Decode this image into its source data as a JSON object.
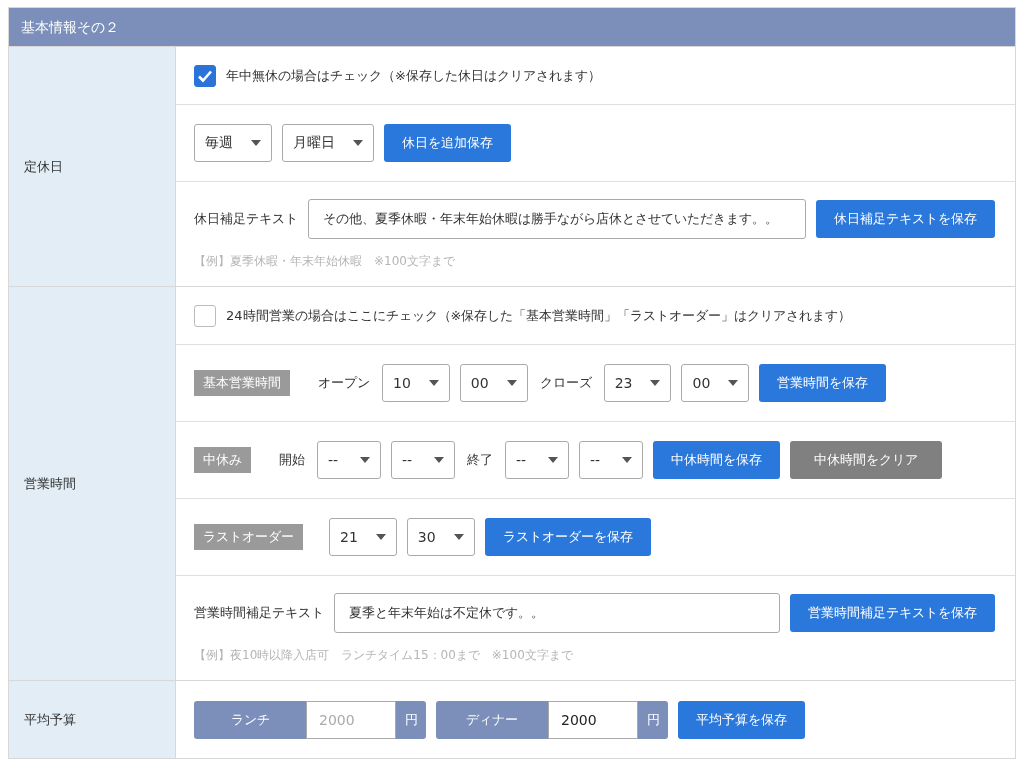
{
  "header": {
    "title": "基本情報その２"
  },
  "sections": [
    {
      "label": "定休日",
      "rows": [
        {
          "kind": "checkbox",
          "label": "年中無休の場合はチェック（※保存した休日はクリアされます）",
          "checked": true
        },
        {
          "kind": "controls",
          "items": [
            {
              "kind": "select",
              "value": "毎週"
            },
            {
              "kind": "select",
              "value": "月曜日"
            },
            {
              "kind": "button",
              "label": "休日を追加保存"
            }
          ]
        },
        {
          "kind": "text",
          "label": "休日補足テキスト",
          "value": "その他、夏季休暇・年末年始休暇は勝手ながら店休とさせていただきます。。",
          "button": "休日補足テキストを保存",
          "hint": "【例】夏季休暇・年末年始休暇　※100文字まで"
        }
      ]
    },
    {
      "label": "営業時間",
      "rows": [
        {
          "kind": "checkbox",
          "label": "24時間営業の場合はここにチェック（※保存した「基本営業時間」「ラストオーダー」はクリアされます）",
          "checked": false
        },
        {
          "kind": "controls",
          "items": [
            {
              "kind": "tag",
              "label": "基本営業時間"
            },
            {
              "kind": "label",
              "label": "オープン"
            },
            {
              "kind": "select",
              "value": "10"
            },
            {
              "kind": "select",
              "value": "00"
            },
            {
              "kind": "label",
              "label": "クローズ"
            },
            {
              "kind": "select",
              "value": "23"
            },
            {
              "kind": "select",
              "value": "00"
            },
            {
              "kind": "button",
              "label": "営業時間を保存"
            }
          ]
        },
        {
          "kind": "controls",
          "items": [
            {
              "kind": "tag",
              "label": "中休み"
            },
            {
              "kind": "label",
              "label": "開始"
            },
            {
              "kind": "select",
              "value": "--"
            },
            {
              "kind": "select",
              "value": "--"
            },
            {
              "kind": "label",
              "label": "終了"
            },
            {
              "kind": "select",
              "value": "--"
            },
            {
              "kind": "select",
              "value": "--"
            },
            {
              "kind": "button",
              "label": "中休時間を保存"
            },
            {
              "kind": "clear",
              "label": "中休時間をクリア"
            }
          ]
        },
        {
          "kind": "controls",
          "items": [
            {
              "kind": "tag",
              "label": "ラストオーダー"
            },
            {
              "kind": "select",
              "value": "21"
            },
            {
              "kind": "select",
              "value": "30"
            },
            {
              "kind": "button",
              "label": "ラストオーダーを保存"
            }
          ]
        },
        {
          "kind": "text",
          "label": "営業時間補足テキスト",
          "value": "夏季と年末年始は不定休です。。",
          "button": "営業時間補足テキストを保存",
          "hint": "【例】夜10時以降入店可　ランチタイム15：00まで　※100文字まで"
        }
      ]
    },
    {
      "label": "平均予算",
      "rows": [
        {
          "kind": "controls",
          "items": [
            {
              "kind": "budget",
              "prefix": "ランチ",
              "placeholder": "2000",
              "suffix": "円"
            },
            {
              "kind": "budget",
              "prefix": "ディナー",
              "value": "2000",
              "suffix": "円"
            },
            {
              "kind": "button",
              "label": "平均予算を保存"
            }
          ]
        }
      ]
    }
  ]
}
